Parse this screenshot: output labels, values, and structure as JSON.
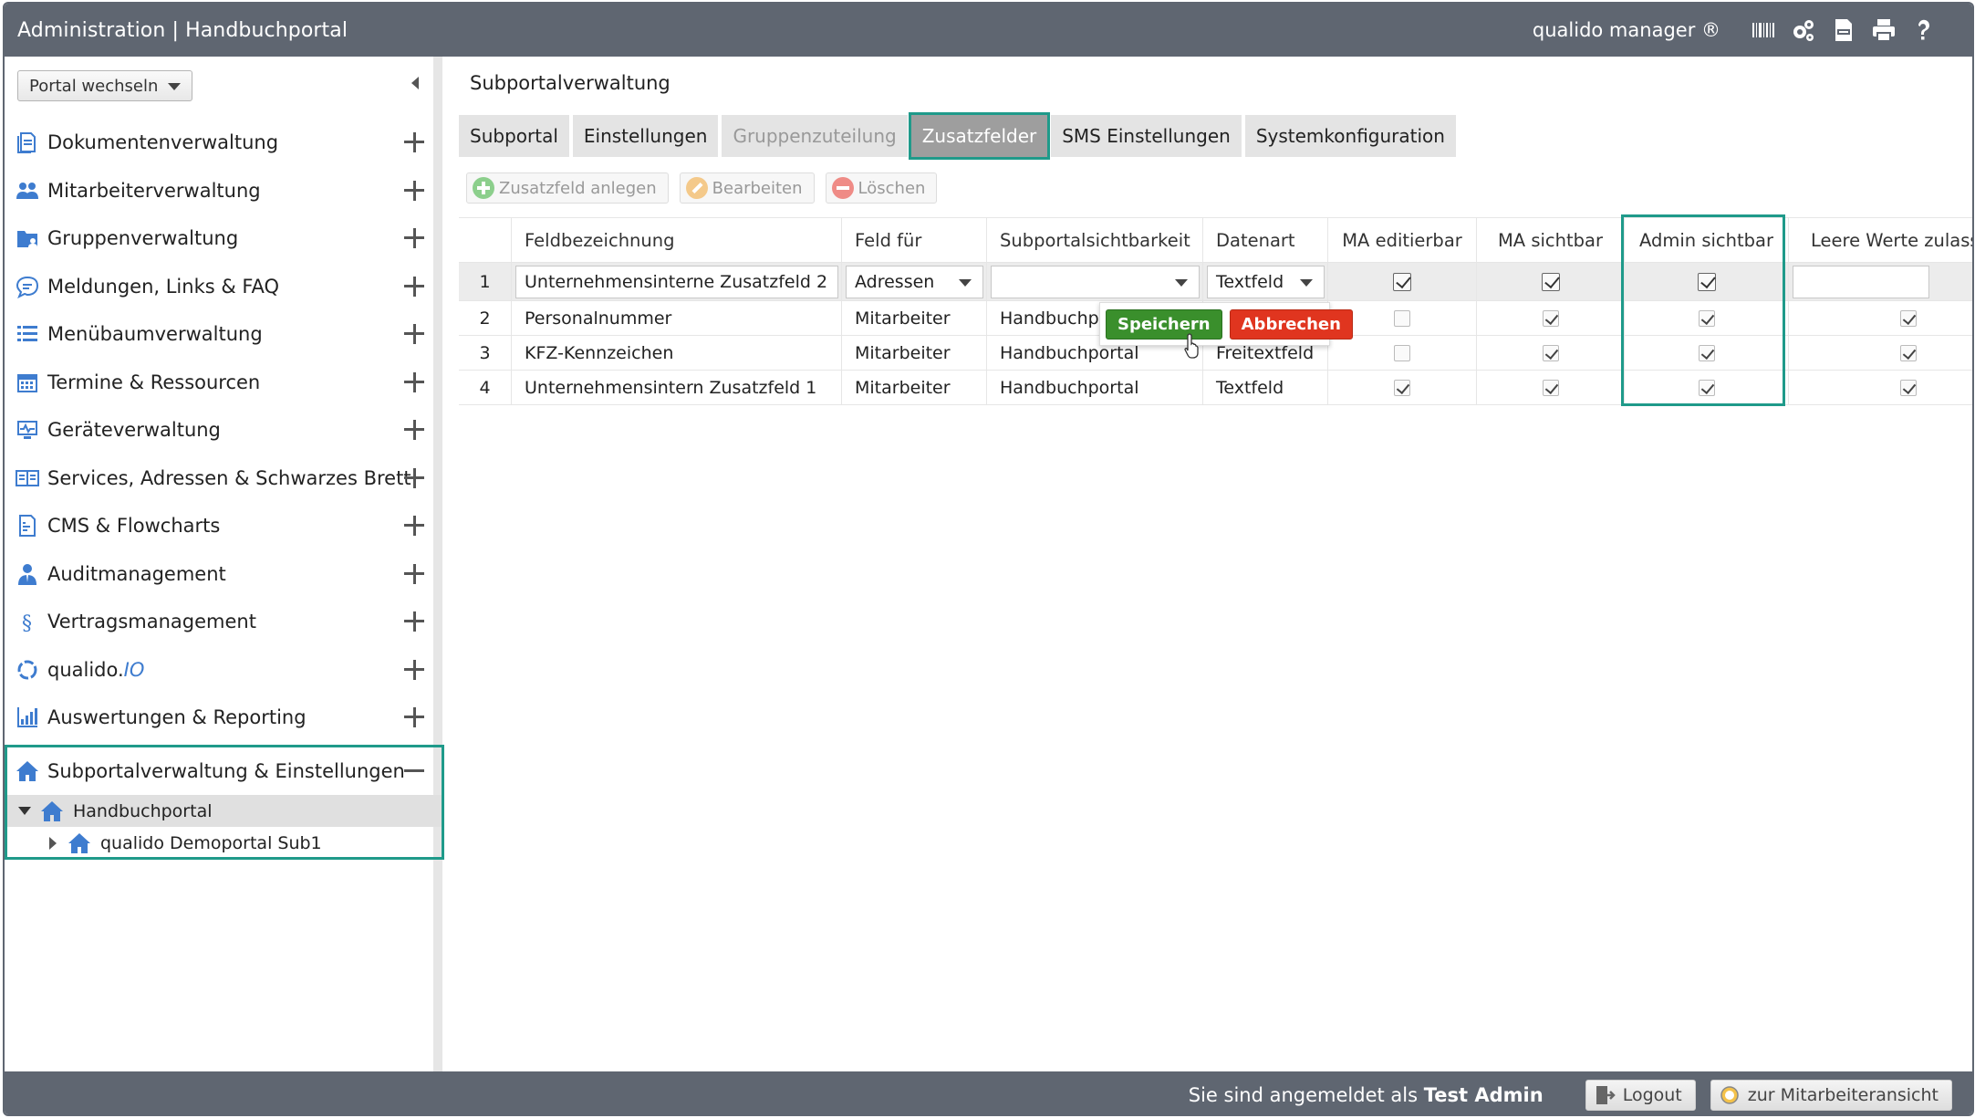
{
  "header": {
    "title": "Administration | Handbuchportal",
    "brand": "qualido manager ®",
    "icons": [
      "barcode-icon",
      "gears-icon",
      "xlsx-export-icon",
      "printer-icon",
      "help-icon"
    ]
  },
  "sidebar": {
    "portal_select": "Portal wechseln",
    "items": [
      {
        "label": "Dokumentenverwaltung",
        "icon": "documents-icon"
      },
      {
        "label": "Mitarbeiterverwaltung",
        "icon": "users-icon"
      },
      {
        "label": "Gruppenverwaltung",
        "icon": "group-folder-icon"
      },
      {
        "label": "Meldungen, Links & FAQ",
        "icon": "speech-bubble-icon"
      },
      {
        "label": "Menübaumverwaltung",
        "icon": "list-icon"
      },
      {
        "label": "Termine & Ressourcen",
        "icon": "calendar-icon"
      },
      {
        "label": "Geräteverwaltung",
        "icon": "monitor-pulse-icon"
      },
      {
        "label": "Services, Adressen & Schwarzes Brett",
        "icon": "book-icon"
      },
      {
        "label": "CMS & Flowcharts",
        "icon": "cms-icon"
      },
      {
        "label": "Auditmanagement",
        "icon": "auditor-icon"
      },
      {
        "label": "Vertragsmanagement",
        "icon": "paragraph-icon"
      },
      {
        "label": "qualido.",
        "label_suffix": "IO",
        "icon": "qualido-io-icon"
      },
      {
        "label": "Auswertungen & Reporting",
        "icon": "bar-chart-icon"
      }
    ],
    "subportal_section": {
      "label": "Subportalverwaltung & Einstellungen",
      "tree": [
        {
          "label": "Handbuchportal",
          "selected": true,
          "expanded": true
        },
        {
          "label": "qualido Demoportal Sub1",
          "selected": false,
          "expanded": false
        }
      ]
    }
  },
  "main": {
    "title": "Subportalverwaltung",
    "tabs": [
      {
        "label": "Subportal",
        "state": "normal"
      },
      {
        "label": "Einstellungen",
        "state": "normal"
      },
      {
        "label": "Gruppenzuteilung",
        "state": "disabled"
      },
      {
        "label": "Zusatzfelder",
        "state": "active"
      },
      {
        "label": "SMS Einstellungen",
        "state": "normal"
      },
      {
        "label": "Systemkonfiguration",
        "state": "normal"
      }
    ],
    "toolbar": {
      "add": "Zusatzfeld anlegen",
      "edit": "Bearbeiten",
      "delete": "Löschen"
    },
    "grid": {
      "columns": [
        "",
        "Feldbezeichnung",
        "Feld für",
        "Subportalsichtbarkeit",
        "Datenart",
        "MA editierbar",
        "MA sichtbar",
        "Admin sichtbar",
        "Leere Werte zulassen"
      ],
      "editing_row": {
        "num": "1",
        "feldbezeichnung": "Unternehmensinterne Zusatzfeld 2",
        "feld_fuer": "Adressen",
        "subportal": "",
        "datenart": "Textfeld",
        "ma_editierbar": true,
        "ma_sichtbar": true,
        "admin_sichtbar": true,
        "leere_werte": ""
      },
      "rows": [
        {
          "num": "2",
          "feldbezeichnung": "Personalnummer",
          "feld_fuer": "Mitarbeiter",
          "subportal": "Handbuchp",
          "datenart": "",
          "ma_editierbar": false,
          "ma_sichtbar": true,
          "admin_sichtbar": true,
          "leere_werte": true
        },
        {
          "num": "3",
          "feldbezeichnung": "KFZ-Kennzeichen",
          "feld_fuer": "Mitarbeiter",
          "subportal": "Handbuchportal",
          "datenart": "Freitextfeld",
          "ma_editierbar": false,
          "ma_sichtbar": true,
          "admin_sichtbar": true,
          "leere_werte": true
        },
        {
          "num": "4",
          "feldbezeichnung": "Unternehmensintern Zusatzfeld 1",
          "feld_fuer": "Mitarbeiter",
          "subportal": "Handbuchportal",
          "datenart": "Textfeld",
          "ma_editierbar": true,
          "ma_sichtbar": true,
          "admin_sichtbar": true,
          "leere_werte": true
        }
      ]
    },
    "popover": {
      "save": "Speichern",
      "cancel": "Abbrechen"
    }
  },
  "footer": {
    "login_prefix": "Sie sind angemeldet als",
    "user": "Test Admin",
    "logout": "Logout",
    "employee_view": "zur Mitarbeiteransicht"
  },
  "colors": {
    "header_bg": "#5f6671",
    "accent_highlight": "#1f9a8a",
    "icon_blue": "#3e7ccf",
    "save_green": "#3a8f2c",
    "cancel_red": "#e0351f"
  }
}
